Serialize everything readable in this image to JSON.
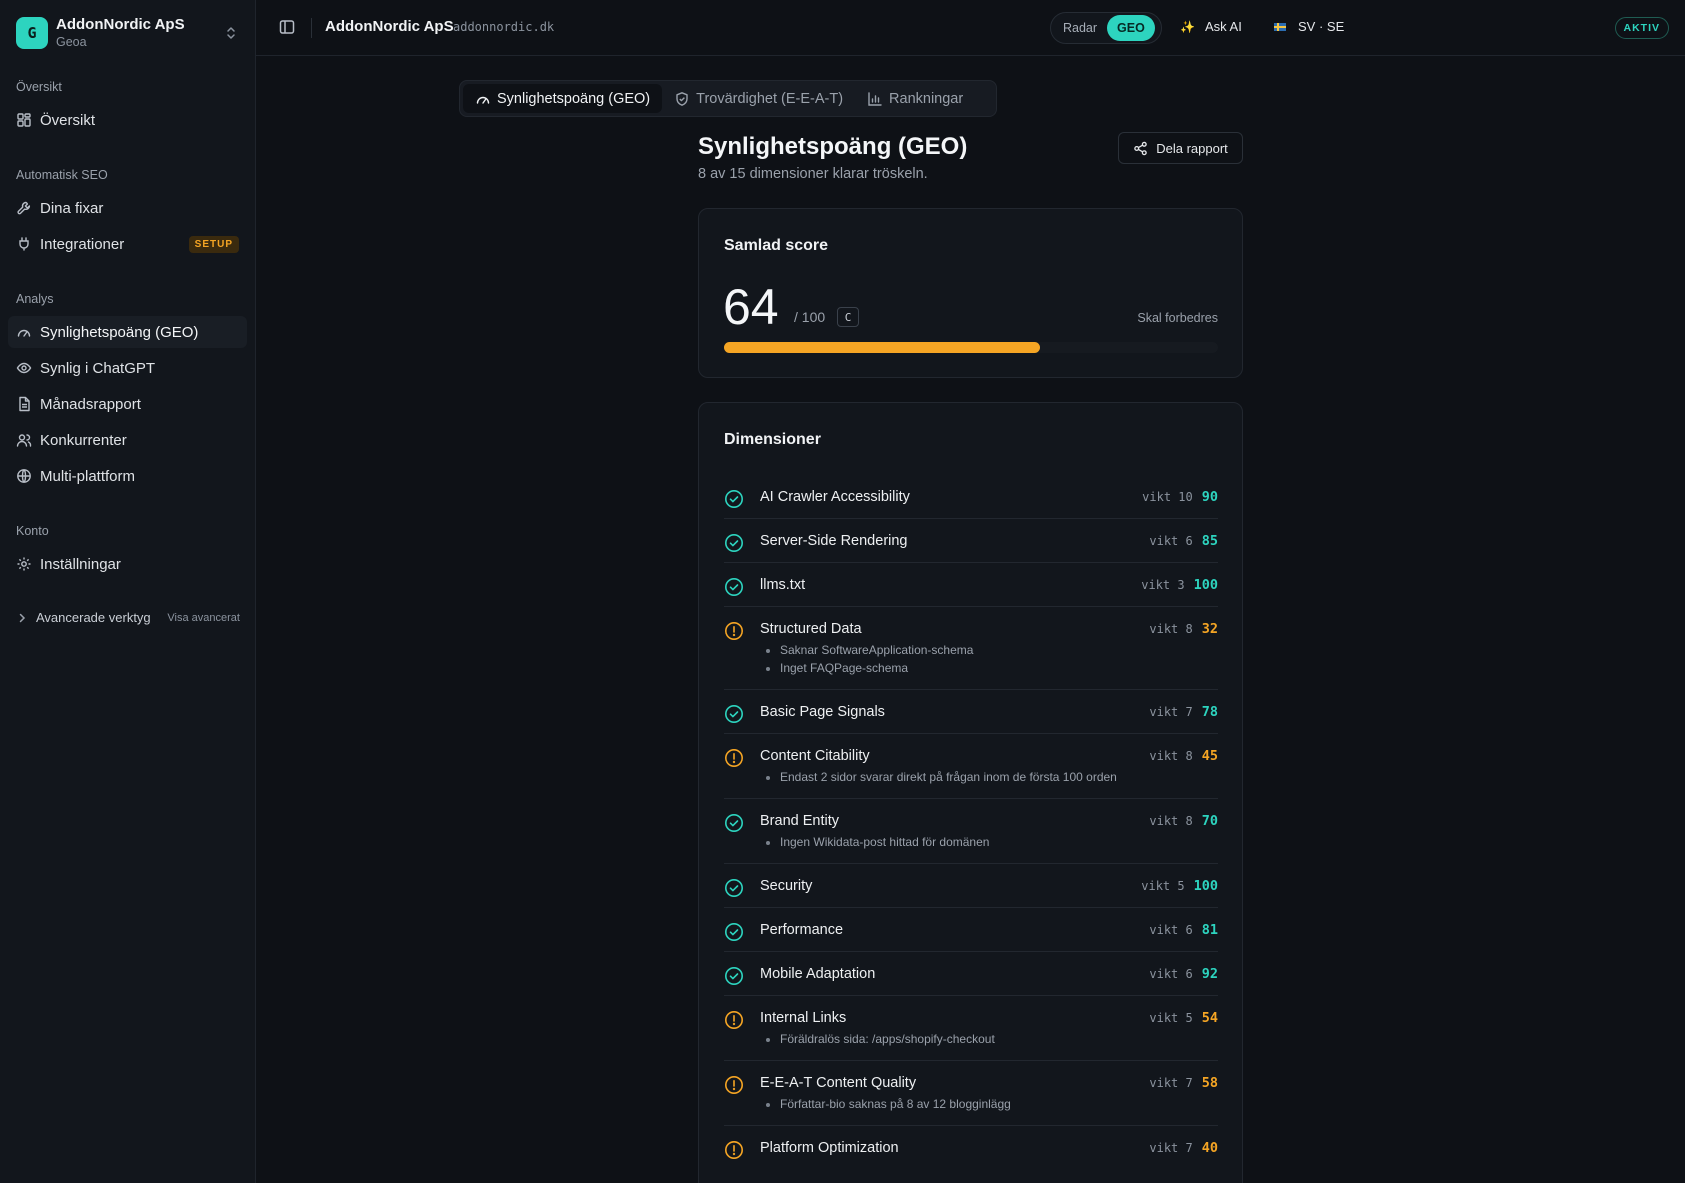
{
  "org": {
    "initial": "G",
    "name": "AddonNordic ApS",
    "sub": "Geoa"
  },
  "nav": {
    "sections": [
      {
        "label": "Översikt",
        "items": [
          {
            "label": "Översikt",
            "icon": "dashboard-icon"
          }
        ]
      },
      {
        "label": "Automatisk SEO",
        "items": [
          {
            "label": "Dina fixar",
            "icon": "wrench-icon"
          },
          {
            "label": "Integrationer",
            "icon": "plug-icon",
            "badge": "SETUP"
          }
        ]
      },
      {
        "label": "Analys",
        "items": [
          {
            "label": "Synlighetspoäng (GEO)",
            "icon": "gauge-icon",
            "active": true
          },
          {
            "label": "Synlig i ChatGPT",
            "icon": "eye-icon"
          },
          {
            "label": "Månadsrapport",
            "icon": "report-icon"
          },
          {
            "label": "Konkurrenter",
            "icon": "users-icon"
          },
          {
            "label": "Multi-plattform",
            "icon": "globe-icon"
          }
        ]
      },
      {
        "label": "Konto",
        "items": [
          {
            "label": "Inställningar",
            "icon": "gear-icon"
          }
        ]
      }
    ],
    "advanced": {
      "label": "Avancerade verktyg",
      "action": "Visa avancerat"
    }
  },
  "topbar": {
    "title": "AddonNordic ApS",
    "domain": "addonnordic.dk",
    "mode": {
      "options": [
        "Radar",
        "GEO"
      ],
      "selected": "GEO"
    },
    "ask_ai": "Ask AI",
    "language": "SV · SE",
    "status": "AKTIV"
  },
  "tabs": [
    {
      "label": "Synlighetspoäng (GEO)",
      "icon": "gauge-icon",
      "active": true
    },
    {
      "label": "Trovärdighet (E-E-A-T)",
      "icon": "shield-icon"
    },
    {
      "label": "Rankningar",
      "icon": "bar-chart-icon"
    }
  ],
  "header": {
    "title": "Synlighetspoäng (GEO)",
    "subtitle": "8 av 15 dimensioner klarar tröskeln.",
    "share_label": "Dela rapport"
  },
  "score": {
    "title": "Samlad score",
    "value": "64",
    "max": "/ 100",
    "grade": "C",
    "status": "Skal forbedres",
    "progress": 0.64,
    "color": "#f5a524"
  },
  "dimensions": {
    "title": "Dimensioner",
    "items": [
      {
        "name": "AI Crawler Accessibility",
        "weight": "vikt 10",
        "score": "90",
        "status": "ok",
        "issues": []
      },
      {
        "name": "Server-Side Rendering",
        "weight": "vikt 6",
        "score": "85",
        "status": "ok",
        "issues": []
      },
      {
        "name": "llms.txt",
        "weight": "vikt 3",
        "score": "100",
        "status": "ok",
        "issues": []
      },
      {
        "name": "Structured Data",
        "weight": "vikt 8",
        "score": "32",
        "status": "warn",
        "issues": [
          "Saknar SoftwareApplication-schema",
          "Inget FAQPage-schema"
        ]
      },
      {
        "name": "Basic Page Signals",
        "weight": "vikt 7",
        "score": "78",
        "status": "ok",
        "issues": []
      },
      {
        "name": "Content Citability",
        "weight": "vikt 8",
        "score": "45",
        "status": "warn",
        "issues": [
          "Endast 2 sidor svarar direkt på frågan inom de första 100 orden"
        ]
      },
      {
        "name": "Brand Entity",
        "weight": "vikt 8",
        "score": "70",
        "status": "ok",
        "issues": [
          "Ingen Wikidata-post hittad för domänen"
        ]
      },
      {
        "name": "Security",
        "weight": "vikt 5",
        "score": "100",
        "status": "ok",
        "issues": []
      },
      {
        "name": "Performance",
        "weight": "vikt 6",
        "score": "81",
        "status": "ok",
        "issues": []
      },
      {
        "name": "Mobile Adaptation",
        "weight": "vikt 6",
        "score": "92",
        "status": "ok",
        "issues": []
      },
      {
        "name": "Internal Links",
        "weight": "vikt 5",
        "score": "54",
        "status": "warn",
        "issues": [
          "Föräldralös sida: /apps/shopify-checkout"
        ]
      },
      {
        "name": "E-E-A-T Content Quality",
        "weight": "vikt 7",
        "score": "58",
        "status": "warn",
        "issues": [
          "Författar-bio saknas på 8 av 12 blogginlägg"
        ]
      },
      {
        "name": "Platform Optimization",
        "weight": "vikt 7",
        "score": "40",
        "status": "warn",
        "issues": []
      }
    ]
  },
  "colors": {
    "accent": "#2dd4bf",
    "warning": "#f5a524",
    "background": "#0e1116"
  }
}
